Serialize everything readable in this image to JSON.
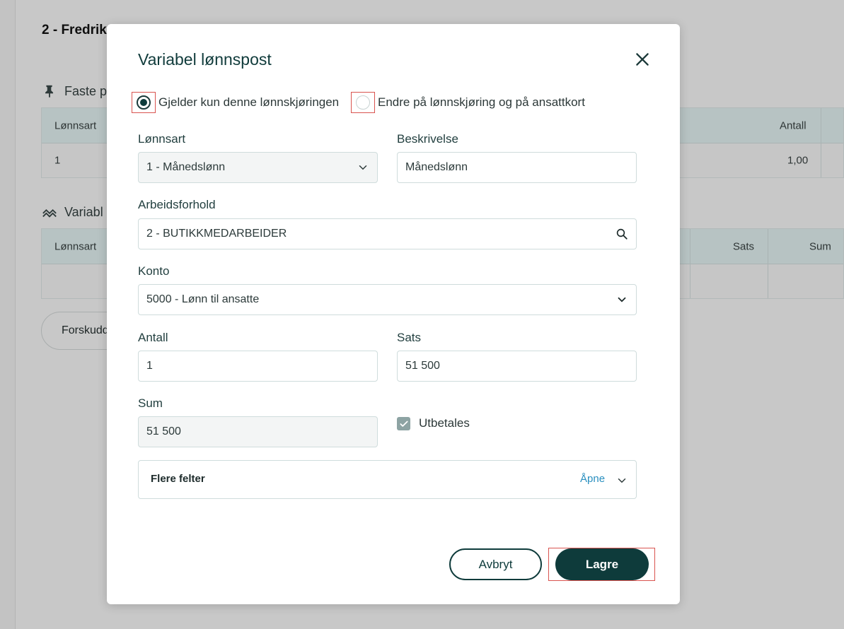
{
  "background": {
    "title": "2 - Fredrik",
    "fixed_section": {
      "label": "Faste p",
      "icon": "pin-icon"
    },
    "fixed_table": {
      "col_lonnsart": "Lønnsart",
      "col_antall": "Antall",
      "row_lonnsart": "1",
      "row_antall": "1,00"
    },
    "variable_section": {
      "label": "Variabl",
      "icon": "chart-trend-icon"
    },
    "variable_table": {
      "col_lonnsart": "Lønnsart",
      "col_sats": "Sats",
      "col_sum": "Sum"
    },
    "button_label": "Forskudd"
  },
  "modal": {
    "title": "Variabel lønnspost",
    "close_icon": "close-icon",
    "radio_options": [
      {
        "label": "Gjelder kun denne lønnskjøringen",
        "selected": true
      },
      {
        "label": "Endre på lønnskjøring og på ansattkort",
        "selected": false
      }
    ],
    "fields": {
      "lonnsart": {
        "label": "Lønnsart",
        "value": "1 - Månedslønn",
        "icon": "chevron-down-icon"
      },
      "beskrivelse": {
        "label": "Beskrivelse",
        "value": "Månedslønn"
      },
      "arbeidsforhold": {
        "label": "Arbeidsforhold",
        "value": "2 - BUTIKKMEDARBEIDER",
        "icon": "search-icon"
      },
      "konto": {
        "label": "Konto",
        "value": "5000 - Lønn til ansatte",
        "icon": "chevron-down-icon"
      },
      "antall": {
        "label": "Antall",
        "value": "1"
      },
      "sats": {
        "label": "Sats",
        "value": "51 500"
      },
      "sum": {
        "label": "Sum",
        "value": "51 500"
      }
    },
    "checkbox": {
      "label": "Utbetales",
      "checked": true
    },
    "more_fields": {
      "title": "Flere felter",
      "action": "Åpne"
    },
    "buttons": {
      "cancel": "Avbryt",
      "save": "Lagre"
    }
  },
  "colors": {
    "primary": "#0e3b3b",
    "link": "#2a8fbf",
    "highlight": "#d9534f"
  }
}
